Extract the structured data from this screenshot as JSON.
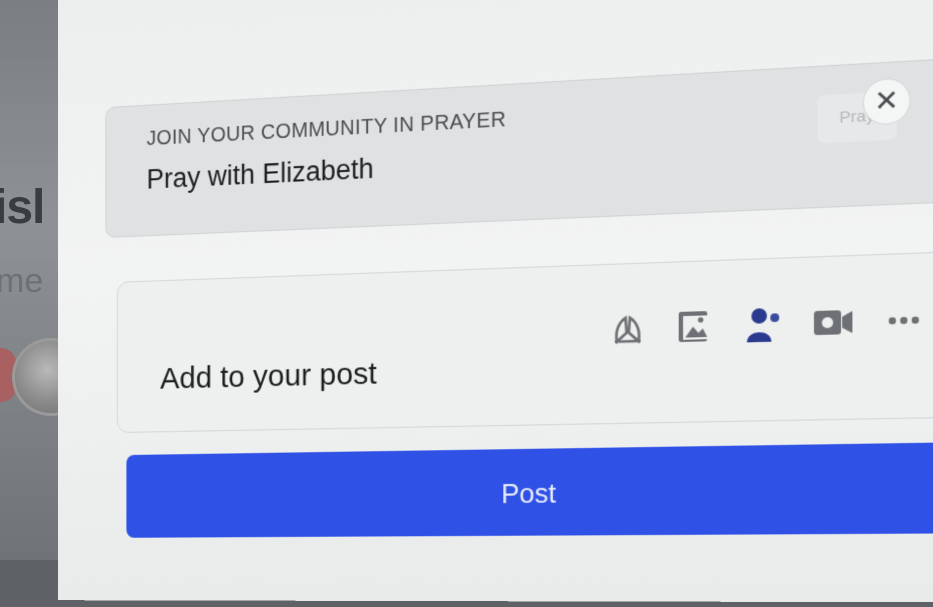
{
  "background": {
    "partial_text_1": "isl",
    "partial_text_2": "me"
  },
  "prayer_card": {
    "heading": "JOIN YOUR COMMUNITY IN PRAYER",
    "title": "Pray with Elizabeth",
    "pray_button": "Pray",
    "close_symbol": "✕"
  },
  "add_to_post": {
    "label": "Add to your post",
    "icons": [
      "praying-hands-icon",
      "photo-icon",
      "tag-people-icon",
      "live-video-icon",
      "more-icon"
    ]
  },
  "post_button": "Post",
  "colors": {
    "primary": "#2f51e6",
    "panel": "#eceeee",
    "text": "#1b1d1f"
  }
}
